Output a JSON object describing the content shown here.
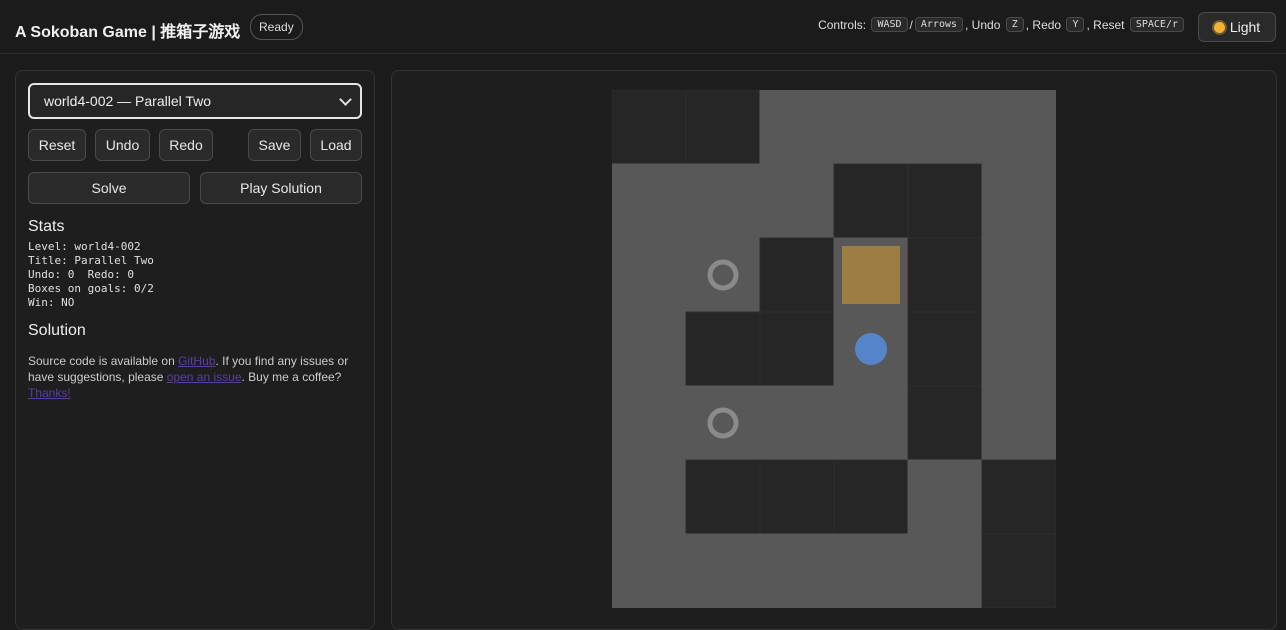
{
  "header": {
    "title": "A Sokoban Game | 推箱子游戏",
    "status": "Ready",
    "controls": {
      "label": "Controls:",
      "wasd": "WASD",
      "slash": "/",
      "arrows": "Arrows",
      "undo_label": ", Undo",
      "undo_key": "Z",
      "redo_label": ", Redo",
      "redo_key": "Y",
      "reset_label": ", Reset",
      "reset_key": "SPACE/r"
    },
    "theme_button": "Light"
  },
  "sidebar": {
    "level_select": "world4-002 — Parallel Two",
    "buttons": {
      "reset": "Reset",
      "undo": "Undo",
      "redo": "Redo",
      "save": "Save",
      "load": "Load",
      "solve": "Solve",
      "play_solution": "Play Solution"
    },
    "stats_title": "Stats",
    "stats": {
      "level": "Level: world4-002",
      "title": "Title: Parallel Two",
      "undo_redo": "Undo: 0  Redo: 0",
      "boxes": "Boxes on goals: 0/2",
      "win": "Win: NO"
    },
    "solution_title": "Solution",
    "solution_text": {
      "part1": "Source code is available on ",
      "github": "GitHub",
      "part2": ". If you find any issues or have suggestions, please ",
      "issue": "open an issue",
      "part3": ". Buy me a coffee? ",
      "thanks": "Thanks!"
    }
  },
  "board": {
    "cols": 6,
    "rows": 7,
    "grid": [
      "##    ",
      "   ## ",
      " .#$# ",
      " ##@# ",
      " .  # ",
      " ### #",
      "     #"
    ],
    "colors": {
      "wall": "#585858",
      "floor": "#262626",
      "box": "#9e7d42",
      "goal": "#8a8a8a",
      "player": "#5585c8",
      "bg": "#1b1b1b",
      "panel": "#1e1e1e"
    }
  }
}
